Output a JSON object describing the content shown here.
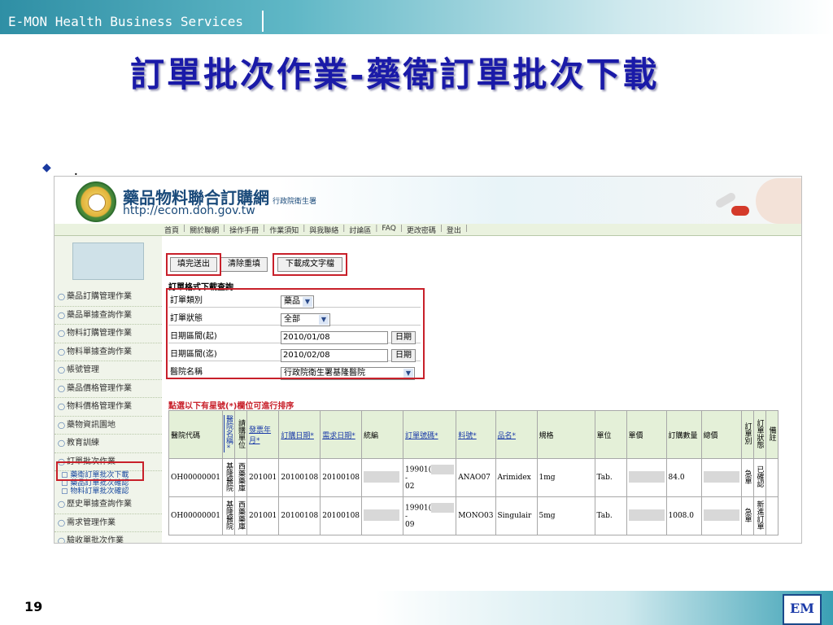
{
  "slide": {
    "brand": "E-MON Health Business Services",
    "title": "訂單批次作業-藥衛訂單批次下載",
    "bullet_dot": "．",
    "page_number": "19",
    "logo_text": "EM"
  },
  "site": {
    "name": "藥品物料聯合訂購網",
    "gov": "行政院衛生署",
    "url": "http://ecom.doh.gov.tw"
  },
  "nav": [
    "首頁",
    "關於聯網",
    "操作手冊",
    "作業須知",
    "與我聯絡",
    "討論區",
    "FAQ",
    "更改密碼",
    "登出"
  ],
  "sidebar": {
    "items": [
      "藥品訂購管理作業",
      "藥品單據查詢作業",
      "物料訂購管理作業",
      "物料單據查詢作業",
      "帳號管理",
      "藥品價格管理作業",
      "物料價格管理作業",
      "藥物資訊園地",
      "教育訓練",
      "訂單批次作業"
    ],
    "subitems": [
      "藥衛訂單批次下載",
      "藥品訂單批次確認",
      "物料訂單批次確認"
    ],
    "items_after": [
      "歷史單據查詢作業",
      "需求管理作業",
      "驗收單批次作業"
    ]
  },
  "toolbar": {
    "submit": "填完送出",
    "reset": "清除重填",
    "download": "下載成文字檔"
  },
  "form": {
    "title": "訂單格式下載查詢",
    "rows": [
      {
        "label": "訂單類別",
        "value": "藥品",
        "kind": "select"
      },
      {
        "label": "訂單狀態",
        "value": "全部",
        "kind": "select"
      },
      {
        "label": "日期區間(起)",
        "value": "2010/01/08",
        "kind": "date"
      },
      {
        "label": "日期區間(迄)",
        "value": "2010/02/08",
        "kind": "date"
      },
      {
        "label": "醫院名稱",
        "value": "行政院衛生署基隆醫院",
        "kind": "select"
      }
    ],
    "date_button": "日期"
  },
  "sort_note": "點選以下有星號(*)欄位可進行排序",
  "table": {
    "headers": {
      "hospital_code": "醫院代碼",
      "hospital_name": "醫院名稱*",
      "req_unit": "請購單位",
      "invoice_month": "發票年月*",
      "order_date": "訂購日期*",
      "need_date": "需求日期*",
      "tax_id": "統編",
      "order_no": "訂單號碼*",
      "item_no": "料號*",
      "product": "品名*",
      "spec": "規格",
      "unit": "單位",
      "price": "單價",
      "qty": "訂購數量",
      "total": "總價",
      "order_type": "訂單別",
      "order_status": "訂單狀態",
      "remark": "備註"
    },
    "rows": [
      {
        "hospital_code": "OH00000001",
        "hospital_name": "基隆醫院",
        "req_unit": "西藥藥庫",
        "invoice_month": "201001",
        "order_date": "20100108",
        "need_date": "20100108",
        "order_no_a": "19901(",
        "order_no_b": "-",
        "order_no_c": "02",
        "item_no": "ANAO07",
        "product": "Arimidex",
        "spec": "1mg",
        "unit": "Tab.",
        "qty": "84.0",
        "order_type": "急單",
        "order_status": "已確認"
      },
      {
        "hospital_code": "OH00000001",
        "hospital_name": "基隆醫院",
        "req_unit": "西藥藥庫",
        "invoice_month": "201001",
        "order_date": "20100108",
        "need_date": "20100108",
        "order_no_a": "19901(",
        "order_no_b": "-",
        "order_no_c": "09",
        "item_no": "MONO03",
        "product": "Singulair",
        "spec": "5mg",
        "unit": "Tab.",
        "qty": "1008.0",
        "order_type": "急單",
        "order_status": "新進訂單"
      }
    ]
  }
}
